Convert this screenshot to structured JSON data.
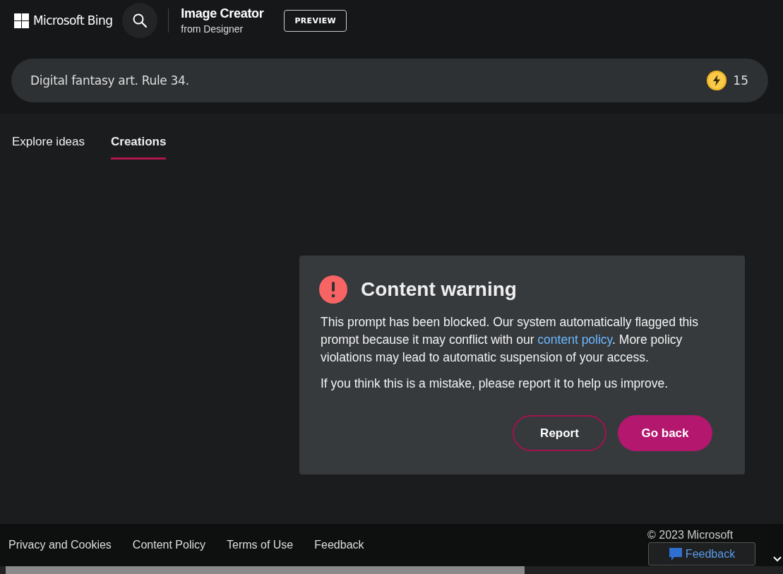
{
  "header": {
    "brand": "Microsoft Bing",
    "title": "Image Creator",
    "subtitle": "from Designer",
    "badge": "PREVIEW"
  },
  "prompt": {
    "value": "Digital fantasy art. Rule 34.",
    "boosts": "15"
  },
  "tabs": [
    {
      "label": "Explore ideas",
      "selected": false
    },
    {
      "label": "Creations",
      "selected": true
    }
  ],
  "dialog": {
    "title": "Content warning",
    "message_before": "This prompt has been blocked. Our system automatically flagged this prompt because it may conflict with our ",
    "link": "content policy",
    "message_after": ". More policy violations may lead to automatic suspension of your access.",
    "note": "If you think this is a mistake, please report it to help us improve.",
    "buttons": [
      {
        "label": "Report",
        "kind": "secondary"
      },
      {
        "label": "Go back",
        "kind": "primary"
      }
    ]
  },
  "footer": {
    "links": [
      "Privacy and Cookies",
      "Content Policy",
      "Terms of Use",
      "Feedback"
    ],
    "copyright": "© 2023 Microsoft",
    "feedback_button": "Feedback"
  }
}
